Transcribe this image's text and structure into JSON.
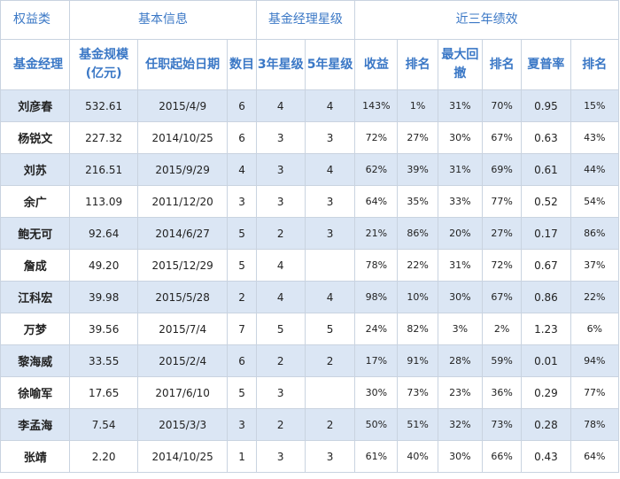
{
  "groups": {
    "equity": "权益类",
    "basic": "基本信息",
    "stars": "基金经理星级",
    "perf": "近三年绩效"
  },
  "columns": [
    "基金经理",
    "基金规模(亿元)",
    "任职起始日期",
    "数目",
    "3年星级",
    "5年星级",
    "收益",
    "排名",
    "最大回撤",
    "排名",
    "夏普率",
    "排名"
  ],
  "rows": [
    [
      "刘彦春",
      "532.61",
      "2015/4/9",
      "6",
      "4",
      "4",
      "143%",
      "1%",
      "31%",
      "70%",
      "0.95",
      "15%"
    ],
    [
      "杨锐文",
      "227.32",
      "2014/10/25",
      "6",
      "3",
      "3",
      "72%",
      "27%",
      "30%",
      "67%",
      "0.63",
      "43%"
    ],
    [
      "刘苏",
      "216.51",
      "2015/9/29",
      "4",
      "3",
      "4",
      "62%",
      "39%",
      "31%",
      "69%",
      "0.61",
      "44%"
    ],
    [
      "余广",
      "113.09",
      "2011/12/20",
      "3",
      "3",
      "3",
      "64%",
      "35%",
      "33%",
      "77%",
      "0.52",
      "54%"
    ],
    [
      "鲍无可",
      "92.64",
      "2014/6/27",
      "5",
      "2",
      "3",
      "21%",
      "86%",
      "20%",
      "27%",
      "0.17",
      "86%"
    ],
    [
      "詹成",
      "49.20",
      "2015/12/29",
      "5",
      "4",
      "",
      "78%",
      "22%",
      "31%",
      "72%",
      "0.67",
      "37%"
    ],
    [
      "江科宏",
      "39.98",
      "2015/5/28",
      "2",
      "4",
      "4",
      "98%",
      "10%",
      "30%",
      "67%",
      "0.86",
      "22%"
    ],
    [
      "万梦",
      "39.56",
      "2015/7/4",
      "7",
      "5",
      "5",
      "24%",
      "82%",
      "3%",
      "2%",
      "1.23",
      "6%"
    ],
    [
      "黎海威",
      "33.55",
      "2015/2/4",
      "6",
      "2",
      "2",
      "17%",
      "91%",
      "28%",
      "59%",
      "0.01",
      "94%"
    ],
    [
      "徐喻军",
      "17.65",
      "2017/6/10",
      "5",
      "3",
      "",
      "30%",
      "73%",
      "23%",
      "36%",
      "0.29",
      "77%"
    ],
    [
      "李孟海",
      "7.54",
      "2015/3/3",
      "3",
      "2",
      "2",
      "50%",
      "51%",
      "32%",
      "73%",
      "0.28",
      "78%"
    ],
    [
      "张靖",
      "2.20",
      "2014/10/25",
      "1",
      "3",
      "3",
      "61%",
      "40%",
      "30%",
      "66%",
      "0.43",
      "64%"
    ]
  ]
}
